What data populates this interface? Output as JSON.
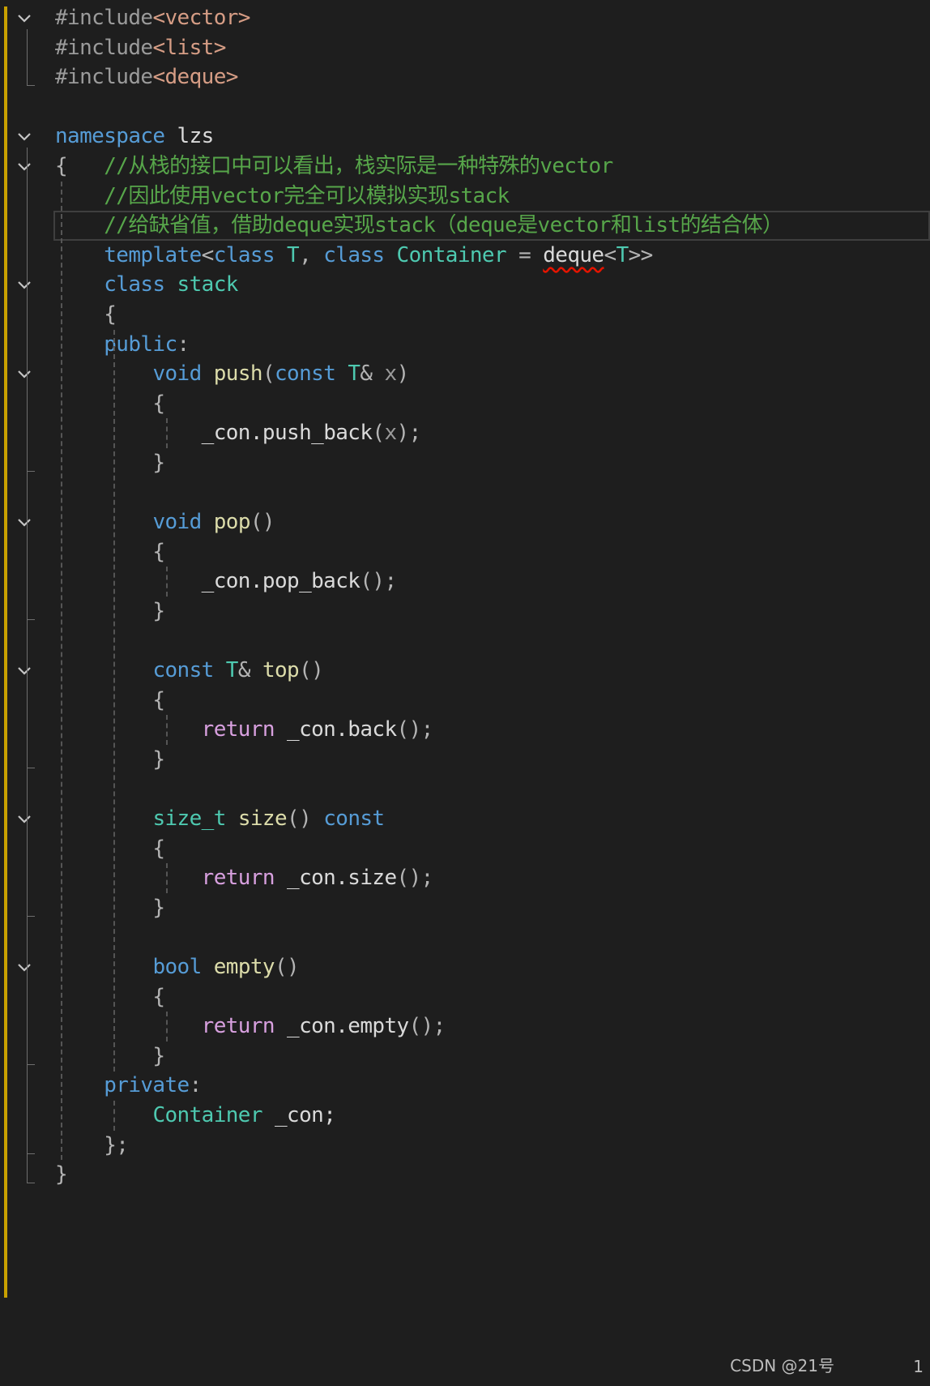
{
  "editor": {
    "lines": [
      [
        {
          "t": "#include",
          "c": "pp"
        },
        {
          "t": "<vector>",
          "c": "str"
        }
      ],
      [
        {
          "t": "#include",
          "c": "pp"
        },
        {
          "t": "<list>",
          "c": "str"
        }
      ],
      [
        {
          "t": "#include",
          "c": "pp"
        },
        {
          "t": "<deque>",
          "c": "str"
        }
      ],
      [],
      [
        {
          "t": "namespace",
          "c": "kw"
        },
        {
          "t": " lzs",
          "c": "ident"
        }
      ],
      [
        {
          "t": "{",
          "c": "punc"
        },
        {
          "t": "   //从栈的接口中可以看出，栈实际是一种特殊的vector",
          "c": "cmt"
        }
      ],
      [
        {
          "t": "    //因此使用vector完全可以模拟实现stack",
          "c": "cmt"
        }
      ],
      [
        {
          "t": "    //给缺省值，借助deque实现stack（deque是vector和list的结合体）",
          "c": "cmt"
        }
      ],
      [
        {
          "t": "    ",
          "c": "punc"
        },
        {
          "t": "template",
          "c": "kw"
        },
        {
          "t": "<",
          "c": "punc"
        },
        {
          "t": "class",
          "c": "kw"
        },
        {
          "t": " T",
          "c": "type"
        },
        {
          "t": ", ",
          "c": "punc"
        },
        {
          "t": "class",
          "c": "kw"
        },
        {
          "t": " Container",
          "c": "type"
        },
        {
          "t": " = ",
          "c": "punc"
        },
        {
          "t": "deque",
          "c": "ident",
          "sq": true
        },
        {
          "t": "<",
          "c": "punc"
        },
        {
          "t": "T",
          "c": "type"
        },
        {
          "t": ">>",
          "c": "punc"
        }
      ],
      [
        {
          "t": "    ",
          "c": "punc"
        },
        {
          "t": "class",
          "c": "kw"
        },
        {
          "t": " stack",
          "c": "type"
        }
      ],
      [
        {
          "t": "    {",
          "c": "punc"
        }
      ],
      [
        {
          "t": "    ",
          "c": "punc"
        },
        {
          "t": "public",
          "c": "kw"
        },
        {
          "t": ":",
          "c": "punc"
        }
      ],
      [
        {
          "t": "        ",
          "c": "punc"
        },
        {
          "t": "void",
          "c": "kw"
        },
        {
          "t": " push",
          "c": "fn"
        },
        {
          "t": "(",
          "c": "punc"
        },
        {
          "t": "const",
          "c": "kw"
        },
        {
          "t": " T",
          "c": "type"
        },
        {
          "t": "& ",
          "c": "punc"
        },
        {
          "t": "x",
          "c": "param"
        },
        {
          "t": ")",
          "c": "punc"
        }
      ],
      [
        {
          "t": "        {",
          "c": "punc"
        }
      ],
      [
        {
          "t": "            _con.",
          "c": "ident"
        },
        {
          "t": "push_back",
          "c": "ident"
        },
        {
          "t": "(",
          "c": "punc"
        },
        {
          "t": "x",
          "c": "param"
        },
        {
          "t": ");",
          "c": "punc"
        }
      ],
      [
        {
          "t": "        }",
          "c": "punc"
        }
      ],
      [],
      [
        {
          "t": "        ",
          "c": "punc"
        },
        {
          "t": "void",
          "c": "kw"
        },
        {
          "t": " pop",
          "c": "fn"
        },
        {
          "t": "()",
          "c": "punc"
        }
      ],
      [
        {
          "t": "        {",
          "c": "punc"
        }
      ],
      [
        {
          "t": "            _con.pop_back",
          "c": "ident"
        },
        {
          "t": "();",
          "c": "punc"
        }
      ],
      [
        {
          "t": "        }",
          "c": "punc"
        }
      ],
      [],
      [
        {
          "t": "        ",
          "c": "punc"
        },
        {
          "t": "const",
          "c": "kw"
        },
        {
          "t": " T",
          "c": "type"
        },
        {
          "t": "& ",
          "c": "punc"
        },
        {
          "t": "top",
          "c": "fn"
        },
        {
          "t": "()",
          "c": "punc"
        }
      ],
      [
        {
          "t": "        {",
          "c": "punc"
        }
      ],
      [
        {
          "t": "            ",
          "c": "punc"
        },
        {
          "t": "return",
          "c": "ctl"
        },
        {
          "t": " _con.back",
          "c": "ident"
        },
        {
          "t": "();",
          "c": "punc"
        }
      ],
      [
        {
          "t": "        }",
          "c": "punc"
        }
      ],
      [],
      [
        {
          "t": "        ",
          "c": "punc"
        },
        {
          "t": "size_t",
          "c": "type"
        },
        {
          "t": " size",
          "c": "fn"
        },
        {
          "t": "() ",
          "c": "punc"
        },
        {
          "t": "const",
          "c": "kw"
        }
      ],
      [
        {
          "t": "        {",
          "c": "punc"
        }
      ],
      [
        {
          "t": "            ",
          "c": "punc"
        },
        {
          "t": "return",
          "c": "ctl"
        },
        {
          "t": " _con.size",
          "c": "ident"
        },
        {
          "t": "();",
          "c": "punc"
        }
      ],
      [
        {
          "t": "        }",
          "c": "punc"
        }
      ],
      [],
      [
        {
          "t": "        ",
          "c": "punc"
        },
        {
          "t": "bool",
          "c": "kw"
        },
        {
          "t": " empty",
          "c": "fn"
        },
        {
          "t": "()",
          "c": "punc"
        }
      ],
      [
        {
          "t": "        {",
          "c": "punc"
        }
      ],
      [
        {
          "t": "            ",
          "c": "punc"
        },
        {
          "t": "return",
          "c": "ctl"
        },
        {
          "t": " _con.empty",
          "c": "ident"
        },
        {
          "t": "();",
          "c": "punc"
        }
      ],
      [
        {
          "t": "        }",
          "c": "punc"
        }
      ],
      [
        {
          "t": "    ",
          "c": "punc"
        },
        {
          "t": "private",
          "c": "kw"
        },
        {
          "t": ":",
          "c": "punc"
        }
      ],
      [
        {
          "t": "        ",
          "c": "punc"
        },
        {
          "t": "Container",
          "c": "type"
        },
        {
          "t": " _con;",
          "c": "ident"
        }
      ],
      [
        {
          "t": "    };",
          "c": "punc"
        }
      ],
      [
        {
          "t": "}",
          "c": "punc"
        }
      ]
    ],
    "current_line_index": 7,
    "fold_lines": [
      0,
      4,
      5,
      9,
      12,
      17,
      22,
      27,
      32
    ]
  },
  "watermark": "CSDN @21号",
  "status_number": "1",
  "colors": {
    "background": "#1e1e1e",
    "keyword": "#569cd6",
    "type": "#4ec9b0",
    "comment": "#57a64a",
    "function": "#dcdcaa",
    "control": "#d8a0df",
    "string": "#d69d85",
    "change_bar": "#c8a000"
  }
}
